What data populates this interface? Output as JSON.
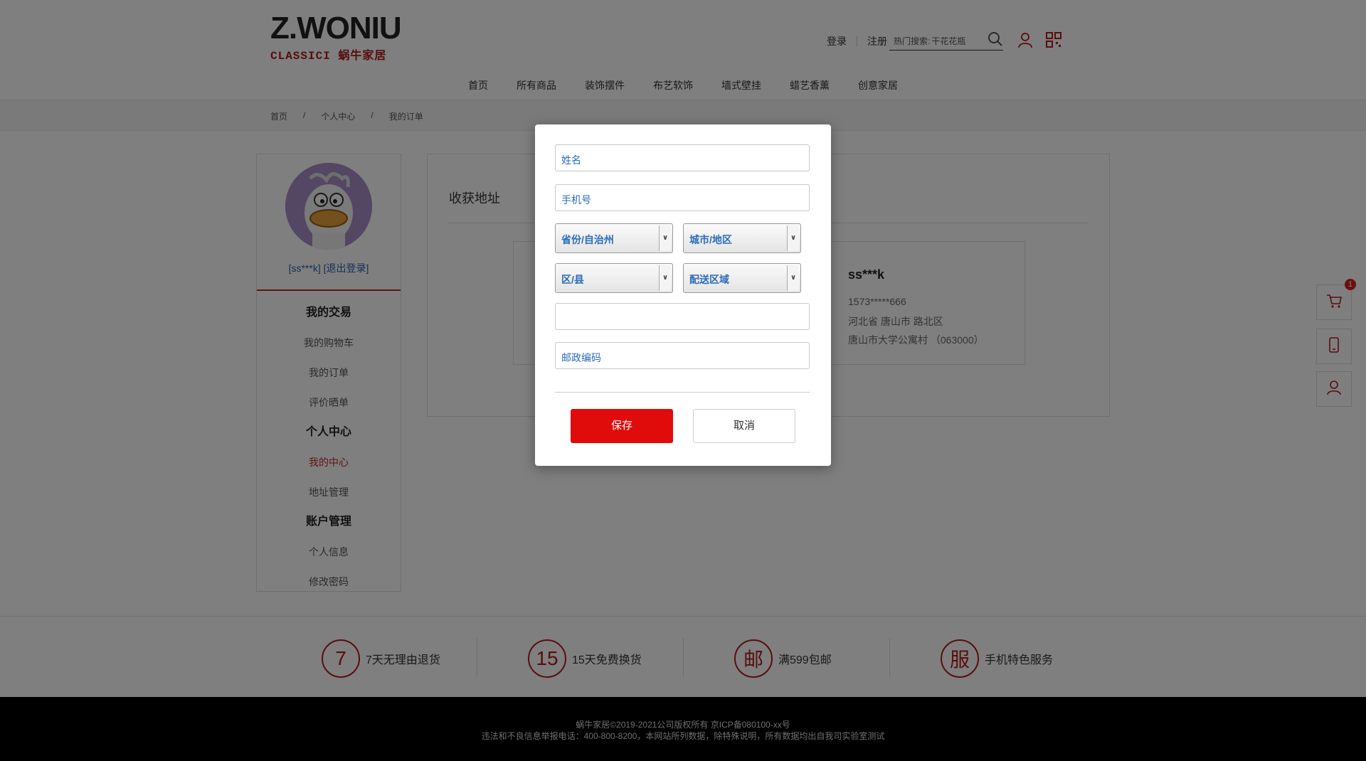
{
  "logo": {
    "top": "Z.WONIU",
    "bottom": "CLASSICI 蜗牛家居"
  },
  "header": {
    "login": "登录",
    "register": "注册",
    "hot_search_label": "热门搜索:",
    "hot_search_value": "干花花瓶",
    "icons": [
      "search-icon",
      "user-icon",
      "qrcode-icon"
    ]
  },
  "nav": [
    "首页",
    "所有商品",
    "装饰摆件",
    "布艺软饰",
    "墙式壁挂",
    "蜡艺香薰",
    "创意家居"
  ],
  "breadcrumb": {
    "items": [
      "首页",
      "个人中心",
      "我的订单"
    ],
    "separator": "/"
  },
  "sidebar": {
    "user": "[ss***k]",
    "logout": "[退出登录]",
    "groups": [
      {
        "title": "我的交易",
        "items": [
          "我的购物车",
          "我的订单",
          "评价晒单"
        ]
      },
      {
        "title": "个人中心",
        "items": [
          "我的中心",
          "地址管理"
        ]
      },
      {
        "title": "账户管理",
        "items": [
          "个人信息",
          "修改密码"
        ]
      }
    ],
    "active_item": "我的中心"
  },
  "main": {
    "title": "收获地址",
    "address": {
      "name": "ss***k",
      "phone": "1573*****666",
      "region": "河北省 唐山市 路北区",
      "detail": "唐山市大学公寓村    （063000）"
    }
  },
  "float_bar": {
    "cart_count": "1",
    "icons": [
      "cart-icon",
      "mobile-icon",
      "user-icon"
    ]
  },
  "services": [
    {
      "badge": "7",
      "text": "7天无理由退货"
    },
    {
      "badge": "15",
      "text": "15天免费换货"
    },
    {
      "badge": "邮",
      "text": "满599包邮"
    },
    {
      "badge": "服",
      "text": "手机特色服务"
    }
  ],
  "footer": {
    "line1": "蜗牛家居©2019-2021公司版权所有 京ICP备080100-xx号",
    "line2": "违法和不良信息举报电话：400-800-8200，本网站所列数据，除特殊说明，所有数据均出自我司实验室测试"
  },
  "modal": {
    "name_placeholder": "姓名",
    "phone_placeholder": "手机号",
    "province": "省份/自治州",
    "city": "城市/地区",
    "district": "区/县",
    "delivery_area": "配送区域",
    "detail_value": "",
    "postcode_placeholder": "邮政编码",
    "save": "保存",
    "cancel": "取消"
  },
  "colors": {
    "brand": "#b31b1b",
    "save_button": "#e00b0b",
    "link": "#2b6cb8"
  }
}
